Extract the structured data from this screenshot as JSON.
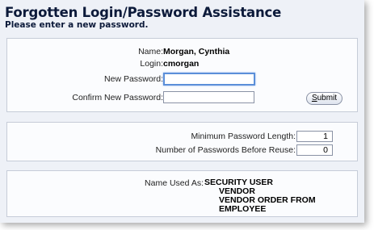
{
  "header": {
    "title": "Forgotten Login/Password Assistance",
    "subtitle": "Please enter a new password."
  },
  "user": {
    "name_label": "Name:",
    "name_value": "Morgan, Cynthia",
    "login_label": "Login:",
    "login_value": "cmorgan"
  },
  "form": {
    "new_password_label": "New Password:",
    "new_password_value": "",
    "confirm_password_label": "Confirm New Password:",
    "confirm_password_value": "",
    "submit_label_first": "S",
    "submit_label_rest": "ubmit"
  },
  "policy": {
    "min_length_label": "Minimum Password Length:",
    "min_length_value": "1",
    "reuse_label": "Number of Passwords Before Reuse:",
    "reuse_value": "0"
  },
  "roles": {
    "label": "Name Used As:",
    "items": [
      "SECURITY USER",
      "VENDOR",
      "VENDOR ORDER FROM",
      "EMPLOYEE"
    ]
  },
  "colors": {
    "accent": "#5b8fd9",
    "title": "#0c1a3a",
    "background": "#eef1f7"
  }
}
